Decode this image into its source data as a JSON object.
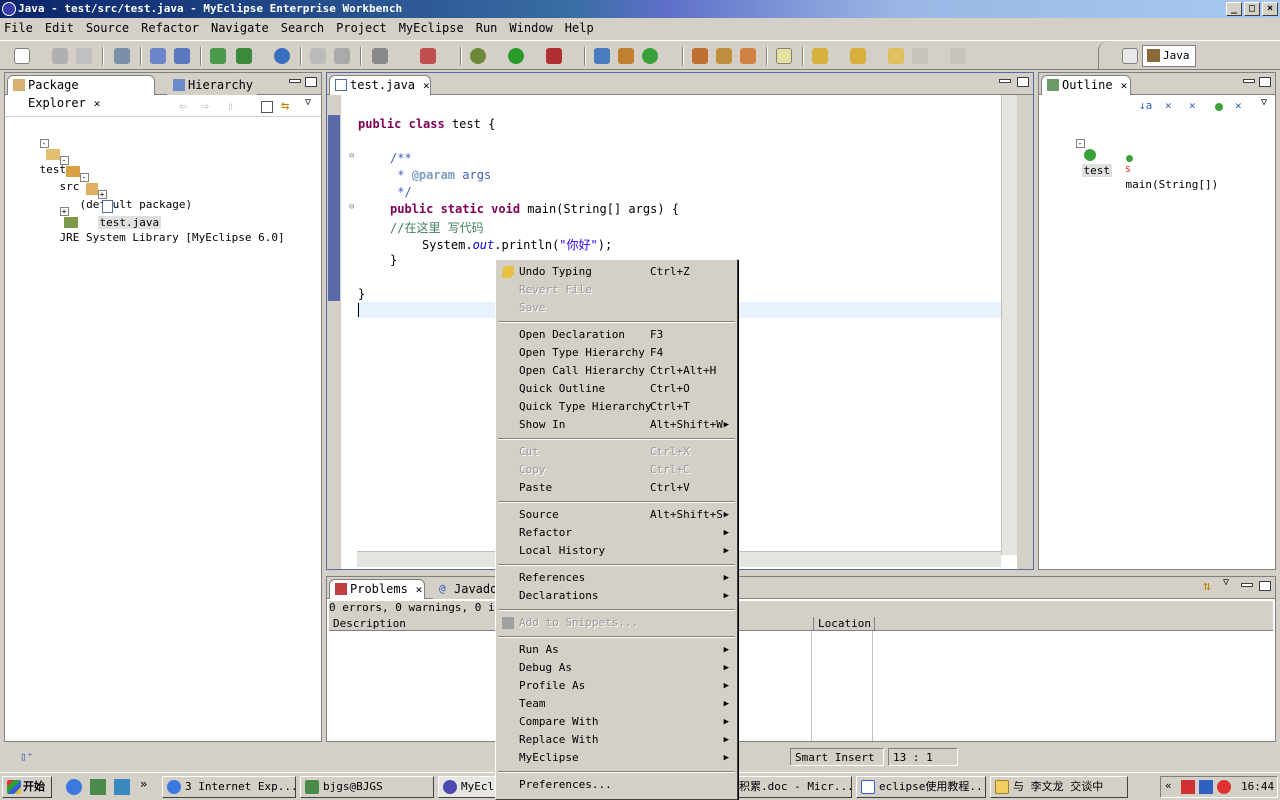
{
  "window": {
    "title": "Java - test/src/test.java - MyEclipse Enterprise Workbench"
  },
  "menu": [
    "File",
    "Edit",
    "Source",
    "Refactor",
    "Navigate",
    "Search",
    "Project",
    "MyEclipse",
    "Run",
    "Window",
    "Help"
  ],
  "perspective": {
    "label": "Java"
  },
  "explorer": {
    "tabs": [
      "Package Explorer",
      "Hierarchy"
    ],
    "tree": {
      "project": "test",
      "src": "src",
      "package": "(default package)",
      "file": "test.java",
      "jre": "JRE System Library [MyEclipse 6.0]"
    }
  },
  "editor": {
    "tab": "test.java",
    "code": {
      "l1_kw1": "public",
      "l1_kw2": "class",
      "l1_rest": " test {",
      "l3": "/**",
      "l4_star": " * ",
      "l4_tag": "@param",
      "l4_rest": " args",
      "l5": " */",
      "l6_kw": "public static void",
      "l6_rest": " main(String[] args) {",
      "l7": "//在这里 写代码",
      "l8_a": "System.",
      "l8_b": "out",
      "l8_c": ".println(",
      "l8_d": "\"你好\"",
      "l8_e": ");",
      "l9": "}",
      "l11": "}"
    }
  },
  "outline": {
    "tab": "Outline",
    "class": "test",
    "method": "main(String[])"
  },
  "bottom": {
    "tabs": [
      "Problems",
      "Javado"
    ],
    "summary": "0 errors, 0 warnings, 0 info",
    "columns": [
      "Description",
      "Location"
    ]
  },
  "context_menu": {
    "items": [
      {
        "label": "Undo Typing",
        "accel": "Ctrl+Z",
        "disabled": false,
        "sub": false
      },
      {
        "label": "Revert File",
        "accel": "",
        "disabled": true,
        "sub": false
      },
      {
        "label": "Save",
        "accel": "",
        "disabled": true,
        "sub": false
      },
      {
        "sep": true
      },
      {
        "label": "Open Declaration",
        "accel": "F3",
        "disabled": false,
        "sub": false
      },
      {
        "label": "Open Type Hierarchy",
        "accel": "F4",
        "disabled": false,
        "sub": false
      },
      {
        "label": "Open Call Hierarchy",
        "accel": "Ctrl+Alt+H",
        "disabled": false,
        "sub": false
      },
      {
        "label": "Quick Outline",
        "accel": "Ctrl+O",
        "disabled": false,
        "sub": false
      },
      {
        "label": "Quick Type Hierarchy",
        "accel": "Ctrl+T",
        "disabled": false,
        "sub": false
      },
      {
        "label": "Show In",
        "accel": "Alt+Shift+W",
        "disabled": false,
        "sub": true
      },
      {
        "sep": true
      },
      {
        "label": "Cut",
        "accel": "Ctrl+X",
        "disabled": true,
        "sub": false
      },
      {
        "label": "Copy",
        "accel": "Ctrl+C",
        "disabled": true,
        "sub": false
      },
      {
        "label": "Paste",
        "accel": "Ctrl+V",
        "disabled": false,
        "sub": false
      },
      {
        "sep": true
      },
      {
        "label": "Source",
        "accel": "Alt+Shift+S",
        "disabled": false,
        "sub": true
      },
      {
        "label": "Refactor",
        "accel": "",
        "disabled": false,
        "sub": true
      },
      {
        "label": "Local History",
        "accel": "",
        "disabled": false,
        "sub": true
      },
      {
        "sep": true
      },
      {
        "label": "References",
        "accel": "",
        "disabled": false,
        "sub": true
      },
      {
        "label": "Declarations",
        "accel": "",
        "disabled": false,
        "sub": true
      },
      {
        "sep": true
      },
      {
        "label": "Add to Snippets...",
        "accel": "",
        "disabled": true,
        "sub": false
      },
      {
        "sep": true
      },
      {
        "label": "Run As",
        "accel": "",
        "disabled": false,
        "sub": true
      },
      {
        "label": "Debug As",
        "accel": "",
        "disabled": false,
        "sub": true
      },
      {
        "label": "Profile As",
        "accel": "",
        "disabled": false,
        "sub": true
      },
      {
        "label": "Team",
        "accel": "",
        "disabled": false,
        "sub": true
      },
      {
        "label": "Compare With",
        "accel": "",
        "disabled": false,
        "sub": true
      },
      {
        "label": "Replace With",
        "accel": "",
        "disabled": false,
        "sub": true
      },
      {
        "label": "MyEclipse",
        "accel": "",
        "disabled": false,
        "sub": true
      },
      {
        "sep": true
      },
      {
        "label": "Preferences...",
        "accel": "",
        "disabled": false,
        "sub": false
      }
    ]
  },
  "status": {
    "mode": "Smart Insert",
    "position": "13 : 1"
  },
  "taskbar": {
    "start": "开始",
    "buttons": [
      "3 Internet Exp...",
      "bjgs@BJGS",
      "MyEcli",
      "积累.doc - Micr...",
      "eclipse使用教程...",
      "与 李文龙 交谈中"
    ],
    "clock": "16:44"
  },
  "colors": {
    "title_start": "#0a246a",
    "keyword": "#7f0055",
    "comment": "#3f5fbf",
    "string": "#2a00ff"
  }
}
